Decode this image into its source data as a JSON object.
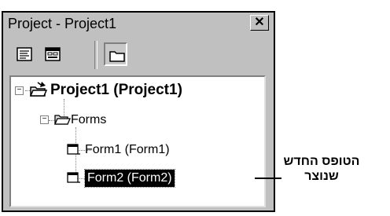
{
  "window": {
    "title": "Project - Project1",
    "close_glyph": "✕"
  },
  "toolbar": {
    "buttons": [
      {
        "name": "view-code",
        "icon": "view-code-icon"
      },
      {
        "name": "view-object",
        "icon": "view-object-icon"
      },
      {
        "name": "toggle-folders",
        "icon": "folder-icon",
        "pressed": true
      }
    ]
  },
  "tree": {
    "project_label": "Project1 (Project1)",
    "forms_label": "Forms",
    "form1_label": "Form1 (Form1)",
    "form2_label": "Form2 (Form2)",
    "expanded_glyph": "−"
  },
  "callout": {
    "line1": "הטופס החדש",
    "line2": "שנוצר"
  }
}
